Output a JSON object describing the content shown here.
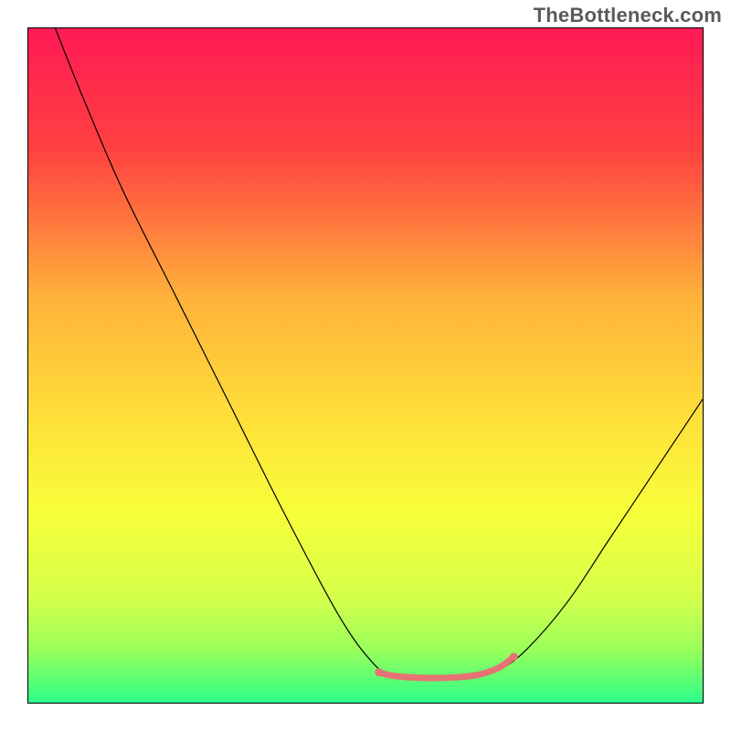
{
  "watermark": "TheBottleneck.com",
  "chart_data": {
    "type": "line",
    "title": "",
    "xlabel": "",
    "ylabel": "",
    "xlim": [
      0,
      100
    ],
    "ylim": [
      0,
      100
    ],
    "gradient_stops": [
      {
        "offset": 0,
        "color": "#ff1a55"
      },
      {
        "offset": 18,
        "color": "#ff4141"
      },
      {
        "offset": 40,
        "color": "#ffb23a"
      },
      {
        "offset": 58,
        "color": "#ffe03a"
      },
      {
        "offset": 72,
        "color": "#f7ff3a"
      },
      {
        "offset": 84,
        "color": "#d6ff4a"
      },
      {
        "offset": 92,
        "color": "#9cff5a"
      },
      {
        "offset": 100,
        "color": "#2cff88"
      }
    ],
    "series": [
      {
        "name": "bottleneck-curve",
        "color": "#000000",
        "width": 1.2,
        "points": [
          {
            "x": 4,
            "y": 100
          },
          {
            "x": 8,
            "y": 90
          },
          {
            "x": 14,
            "y": 76
          },
          {
            "x": 22,
            "y": 60
          },
          {
            "x": 30,
            "y": 44
          },
          {
            "x": 38,
            "y": 28
          },
          {
            "x": 46,
            "y": 13
          },
          {
            "x": 51,
            "y": 6
          },
          {
            "x": 54,
            "y": 4
          },
          {
            "x": 58,
            "y": 3.7
          },
          {
            "x": 62,
            "y": 3.7
          },
          {
            "x": 66,
            "y": 4
          },
          {
            "x": 70,
            "y": 5
          },
          {
            "x": 74,
            "y": 8
          },
          {
            "x": 80,
            "y": 15
          },
          {
            "x": 86,
            "y": 24
          },
          {
            "x": 92,
            "y": 33
          },
          {
            "x": 98,
            "y": 42
          },
          {
            "x": 100,
            "y": 45
          }
        ]
      },
      {
        "name": "low-bottleneck-highlight",
        "color": "#e57373",
        "width": 7,
        "cap": "round",
        "points": [
          {
            "x": 52,
            "y": 4.5
          },
          {
            "x": 54,
            "y": 4
          },
          {
            "x": 58,
            "y": 3.7
          },
          {
            "x": 62,
            "y": 3.7
          },
          {
            "x": 66,
            "y": 4
          },
          {
            "x": 68,
            "y": 4.5
          },
          {
            "x": 70,
            "y": 5.3
          },
          {
            "x": 72,
            "y": 6.8
          }
        ]
      }
    ],
    "markers": [
      {
        "name": "highlight-start-dot",
        "x": 52,
        "y": 4.5,
        "r": 4.5,
        "color": "#e57373"
      },
      {
        "name": "highlight-end-dot",
        "x": 72,
        "y": 6.8,
        "r": 4.5,
        "color": "#e57373"
      }
    ]
  }
}
